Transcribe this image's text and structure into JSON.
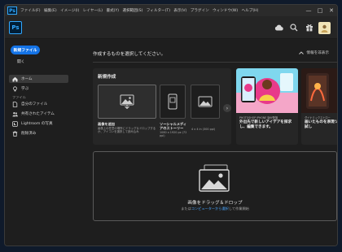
{
  "titlebar": {
    "logo": "Ps",
    "menus": [
      "ファイル(F)",
      "編集(E)",
      "イメージ(I)",
      "レイヤー(L)",
      "書式(Y)",
      "選択範囲(S)",
      "フィルター(T)",
      "表示(V)",
      "プラグイン",
      "ウィンドウ(W)",
      "ヘルプ(H)"
    ],
    "controls": {
      "minimize": "—",
      "maximize": "□",
      "close": "✕"
    }
  },
  "toolbar": {
    "logo": "Ps",
    "icons": [
      "cloud-icon",
      "search-icon",
      "gift-icon",
      "avatar"
    ]
  },
  "sidebar": {
    "new_file_label": "新規ファイル",
    "open_label": "開く",
    "items": [
      {
        "label": "ホーム",
        "icon": "home-icon",
        "active": true
      },
      {
        "label": "学ぶ",
        "icon": "lightbulb-icon",
        "active": false
      }
    ],
    "section_files": "ファイル",
    "file_items": [
      {
        "label": "自分のファイル",
        "icon": "file-icon"
      },
      {
        "label": "共有されたアイテム",
        "icon": "people-icon"
      },
      {
        "label": "Lightroom の写真",
        "icon": "lightroom-icon"
      },
      {
        "label": "削除済み",
        "icon": "trash-icon"
      }
    ]
  },
  "main": {
    "title": "作成するものを選択してください。",
    "hide_info": "情報を非表示",
    "new_create": {
      "title": "新規作成",
      "cards": [
        {
          "title": "画像を追加",
          "sub": "画像上の任意の場所にドラッグ＆ドロップするか、アイコンを選択して読み込み"
        },
        {
          "title": "ソーシャルメディアのストーリー",
          "sub": "1080 x 1920 px (72 ppi)"
        },
        {
          "title": "ウェブ",
          "sub": "4 x 4 in (300 ppi)"
        }
      ]
    },
    "promos": [
      {
        "tag": "PHOTOSHOP IPHONE 版が登場",
        "headline": "外出先で新しいアイデアを探求し、編集できます。"
      },
      {
        "tag": "ダイナミックストロー",
        "headline": "画いたものを表現ツールをお試し"
      }
    ],
    "drop": {
      "title": "画像をドラッグ＆ドロップ",
      "sub_prefix": "または",
      "sub_link": "コンピューターから選択",
      "sub_suffix": "して作業開始"
    }
  },
  "colors": {
    "accent": "#1473e6",
    "ps_blue": "#31a8ff",
    "link": "#4aa6ff"
  }
}
